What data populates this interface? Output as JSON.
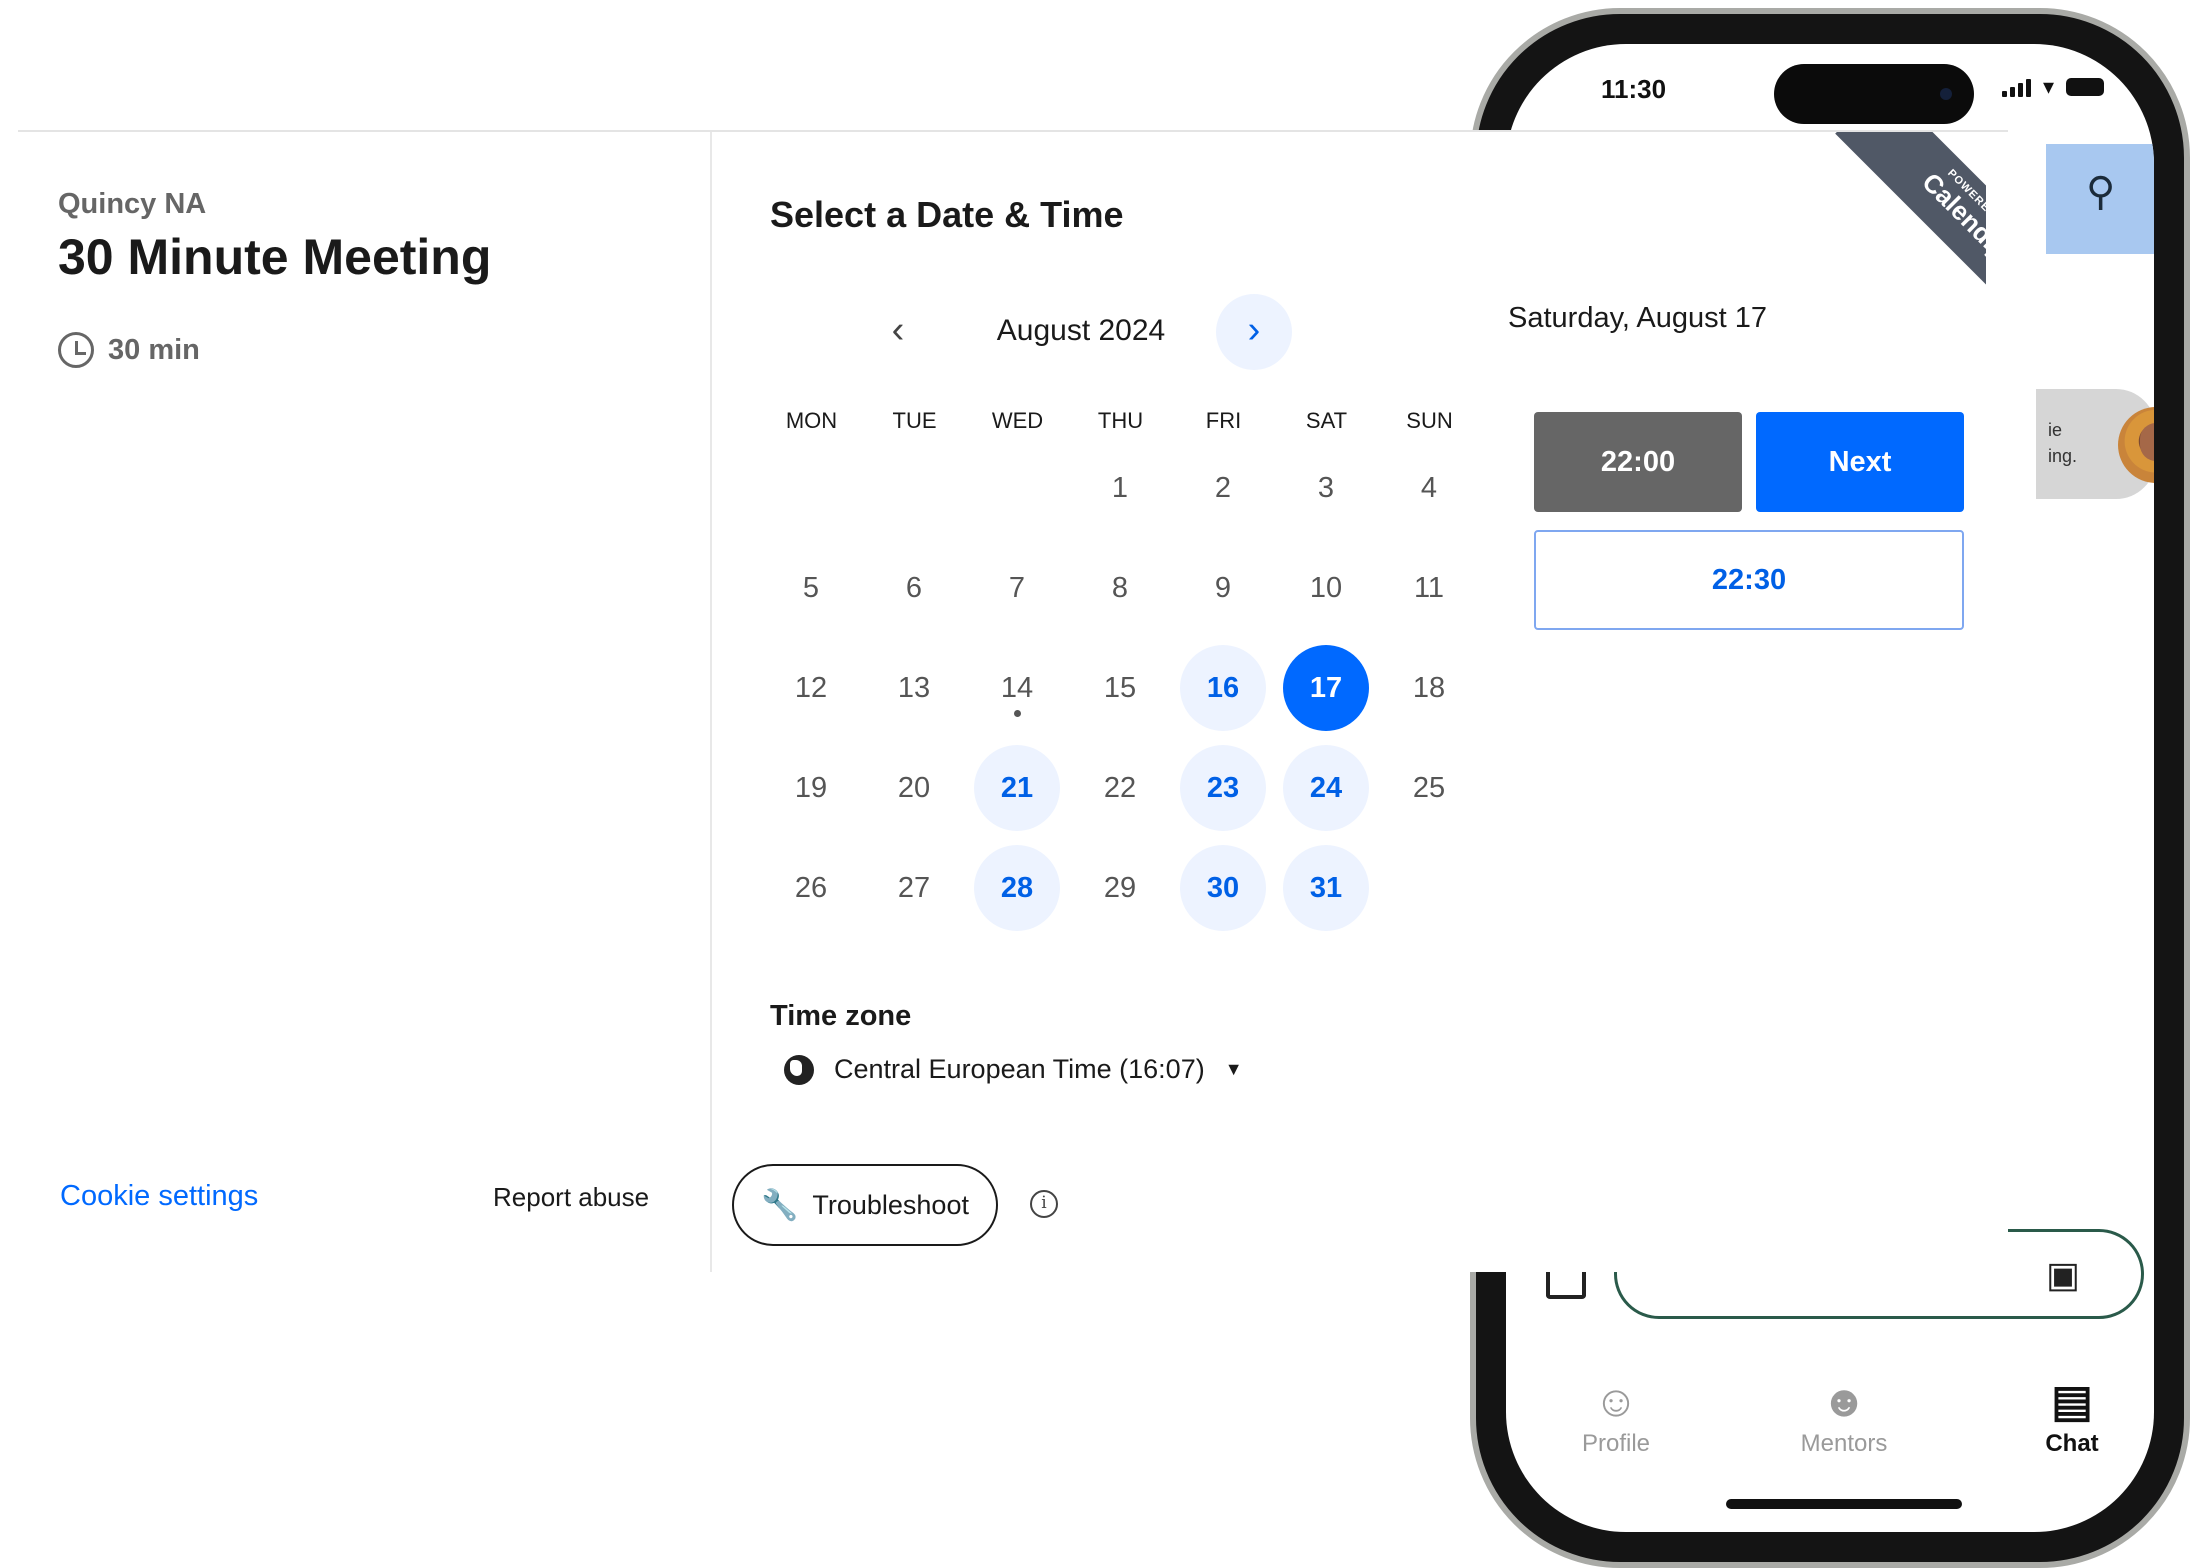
{
  "phone": {
    "status_time": "11:30",
    "bubble_fragment_line1": "ie",
    "bubble_fragment_line2": "ing.",
    "nav": [
      {
        "label": "Profile",
        "icon": "profile-icon"
      },
      {
        "label": "Mentors",
        "icon": "mentors-icon"
      },
      {
        "label": "Chat",
        "icon": "chat-icon"
      }
    ]
  },
  "booking": {
    "host": "Quincy NA",
    "event": "30 Minute Meeting",
    "duration": "30 min",
    "title": "Select a Date & Time",
    "month": "August 2024",
    "weekdays": [
      "MON",
      "TUE",
      "WED",
      "THU",
      "FRI",
      "SAT",
      "SUN"
    ],
    "days": [
      {
        "d": "1",
        "state": "plain"
      },
      {
        "d": "2",
        "state": "plain"
      },
      {
        "d": "3",
        "state": "plain"
      },
      {
        "d": "4",
        "state": "plain"
      },
      {
        "d": "5",
        "state": "plain"
      },
      {
        "d": "6",
        "state": "plain"
      },
      {
        "d": "7",
        "state": "plain"
      },
      {
        "d": "8",
        "state": "plain"
      },
      {
        "d": "9",
        "state": "plain"
      },
      {
        "d": "10",
        "state": "plain"
      },
      {
        "d": "11",
        "state": "plain"
      },
      {
        "d": "12",
        "state": "plain"
      },
      {
        "d": "13",
        "state": "plain"
      },
      {
        "d": "14",
        "state": "today"
      },
      {
        "d": "15",
        "state": "plain"
      },
      {
        "d": "16",
        "state": "available"
      },
      {
        "d": "17",
        "state": "selected"
      },
      {
        "d": "18",
        "state": "plain"
      },
      {
        "d": "19",
        "state": "plain"
      },
      {
        "d": "20",
        "state": "plain"
      },
      {
        "d": "21",
        "state": "available"
      },
      {
        "d": "22",
        "state": "plain"
      },
      {
        "d": "23",
        "state": "available"
      },
      {
        "d": "24",
        "state": "available"
      },
      {
        "d": "25",
        "state": "plain"
      },
      {
        "d": "26",
        "state": "plain"
      },
      {
        "d": "27",
        "state": "plain"
      },
      {
        "d": "28",
        "state": "available"
      },
      {
        "d": "29",
        "state": "plain"
      },
      {
        "d": "30",
        "state": "available"
      },
      {
        "d": "31",
        "state": "available"
      }
    ],
    "timezone_label": "Time zone",
    "timezone": "Central European Time (16:07)",
    "selected_date": "Saturday, August 17",
    "slots": {
      "confirmed": "22:00",
      "next": "Next",
      "option": "22:30"
    },
    "cookie": "Cookie settings",
    "report": "Report abuse",
    "troubleshoot": "Troubleshoot",
    "ribbon_small": "POWERED BY",
    "ribbon_brand": "Calendly",
    "colors": {
      "accent": "#0069ff",
      "available_bg": "#edf3ff",
      "muted": "#666666",
      "appbar": "#a8c8f0"
    }
  }
}
